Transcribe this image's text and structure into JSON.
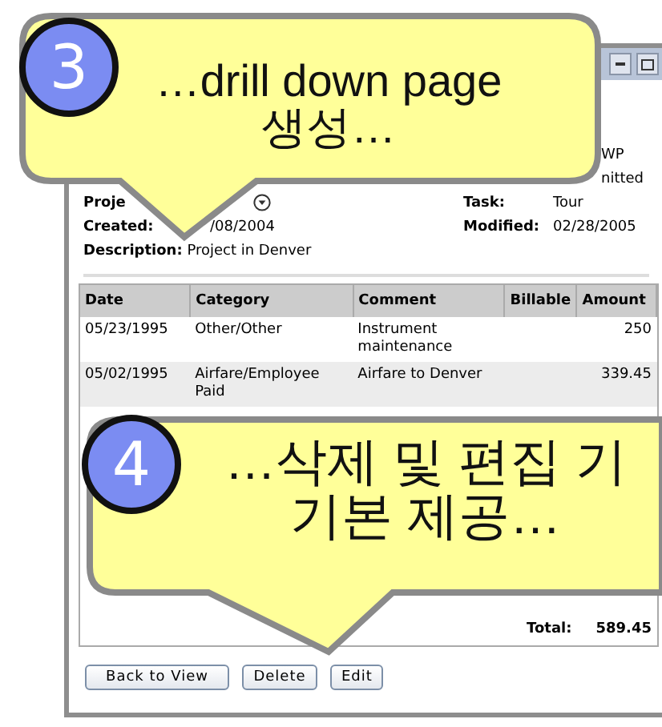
{
  "window": {
    "partial_values": [
      "WP",
      "nitted"
    ],
    "project": {
      "label": "Proje"
    },
    "task": {
      "label": "Task:",
      "value": "Tour"
    },
    "created": {
      "label": "Created:",
      "value": "/08/2004"
    },
    "modified": {
      "label": "Modified:",
      "value": "02/28/2005"
    },
    "description": {
      "label": "Description:",
      "value": "Project in Denver"
    },
    "table": {
      "columns": [
        "Date",
        "Category",
        "Comment",
        "Billable",
        "Amount"
      ],
      "rows": [
        [
          "05/23/1995",
          "Other/Other",
          "Instrument maintenance",
          "",
          "250"
        ],
        [
          "05/02/1995",
          "Airfare/Employee Paid",
          "Airfare to Denver",
          "",
          "339.45"
        ]
      ],
      "total": {
        "label": "Total:",
        "value": "589.45"
      }
    },
    "buttons": [
      "Back to View",
      "Delete",
      "Edit"
    ]
  },
  "callouts": [
    {
      "number": "3",
      "lines": [
        "…drill down page",
        "생성…"
      ]
    },
    {
      "number": "4",
      "lines": [
        "…삭제 및 편집 기",
        "기본 제공…"
      ]
    }
  ]
}
